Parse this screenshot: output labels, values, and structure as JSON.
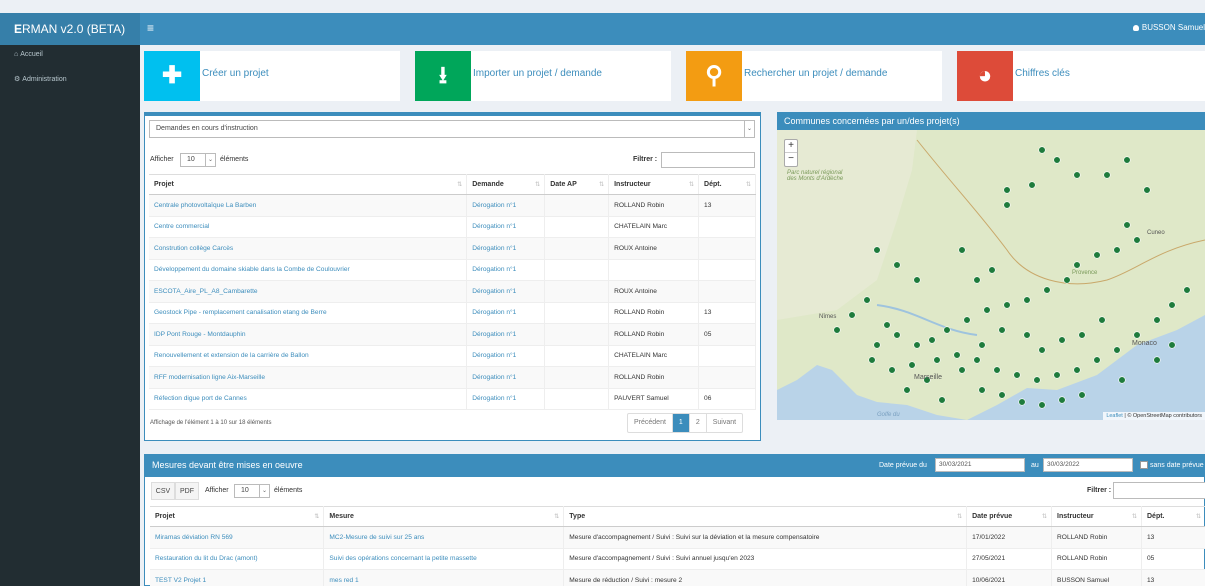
{
  "app": {
    "title_first": "E",
    "title_rest": "RMAN v2.0 (BETA)",
    "menu_glyph": "≡",
    "user": "BUSSON Samuel"
  },
  "sidebar": {
    "items": [
      {
        "icon": "home-icon",
        "label": "Accueil"
      },
      {
        "icon": "cogs-icon",
        "label": "Administration"
      }
    ]
  },
  "tiles": [
    {
      "icon": "plus-icon",
      "glyph": "✚",
      "label": "Créer un projet",
      "color": "#00c0ef"
    },
    {
      "icon": "download-icon",
      "glyph": "⭳",
      "label": "Importer un projet / demande",
      "color": "#00a65a"
    },
    {
      "icon": "search-icon",
      "glyph": "⚲",
      "label": "Rechercher un projet / demande",
      "color": "#f39c12"
    },
    {
      "icon": "pie-chart-icon",
      "glyph": "◕",
      "label": "Chiffres clés",
      "color": "#dd4b39"
    }
  ],
  "requests": {
    "select_value": "Demandes en cours d'instruction",
    "show_label": "Afficher",
    "page_size": "10",
    "elements_label": "éléments",
    "filter_label": "Filtrer :",
    "columns": [
      "Projet",
      "Demande",
      "Date AP",
      "Instructeur",
      "Dépt."
    ],
    "rows": [
      [
        "Centrale photovoltaïque La Barben",
        "Dérogation n°1",
        "",
        "ROLLAND Robin",
        "13"
      ],
      [
        "Centre commercial",
        "Dérogation n°1",
        "",
        "CHATELAIN Marc",
        ""
      ],
      [
        "Constrution collège Carcès",
        "Dérogation n°1",
        "",
        "ROUX Antoine",
        ""
      ],
      [
        "Développement du domaine skiable dans la Combe de Coulouvrier",
        "Dérogation n°1",
        "",
        "",
        ""
      ],
      [
        "ESCOTA_Aire_PL_A8_Cambarette",
        "Dérogation n°1",
        "",
        "ROUX Antoine",
        ""
      ],
      [
        "Geostock Pipe - remplacement canalisation etang de Berre",
        "Dérogation n°1",
        "",
        "ROLLAND Robin",
        "13"
      ],
      [
        "IDP Pont Rouge - Montdauphin",
        "Dérogation n°1",
        "",
        "ROLLAND Robin",
        "05"
      ],
      [
        "Renouvellement et extension de la carrière de Ballon",
        "Dérogation n°1",
        "",
        "CHATELAIN Marc",
        ""
      ],
      [
        "RFF modernisation ligne Aix-Marseille",
        "Dérogation n°1",
        "",
        "ROLLAND Robin",
        ""
      ],
      [
        "Réfection digue port de Cannes",
        "Dérogation n°1",
        "",
        "PAUVERT Samuel",
        "06"
      ]
    ],
    "info": "Affichage de l'élément 1 à 10 sur 18 éléments",
    "pager": {
      "prev": "Précédent",
      "pages": [
        "1",
        "2"
      ],
      "next": "Suivant",
      "current": "1"
    }
  },
  "map": {
    "title": "Communes concernées par un/des projet(s)",
    "zoom_in": "+",
    "zoom_out": "−",
    "attribution_leaflet": "Leaflet",
    "attribution_rest": " | © OpenStreetMap contributors",
    "place_labels": [
      "Parc naturel régional des Monts d'Ardèche",
      "Nîmes",
      "Marseille",
      "Monaco",
      "Cuneo",
      "Provence",
      "Golfe du"
    ],
    "colors": {
      "land": "#dfe8c8",
      "sea": "#b9d3e8",
      "marker": "#1e7b3c"
    }
  },
  "measures": {
    "title": "Mesures devant être mises en oeuvre",
    "date_label": "Date prévue du",
    "date_from": "30/03/2021",
    "date_to_label": "au",
    "date_to": "30/03/2022",
    "no_date_label": "sans date prévue",
    "csv": "CSV",
    "pdf": "PDF",
    "show_label": "Afficher",
    "page_size": "10",
    "elements_label": "éléments",
    "filter_label": "Filtrer :",
    "columns": [
      "Projet",
      "Mesure",
      "Type",
      "Date prévue",
      "Instructeur",
      "Dépt."
    ],
    "rows": [
      [
        "Miramas déviation RN 569",
        "MC2-Mesure de suivi sur 25 ans",
        "Mesure d'accompagnement / Suivi : Suivi sur la déviation et la mesure compensatoire",
        "17/01/2022",
        "ROLLAND Robin",
        "13"
      ],
      [
        "Restauration du lit du Drac (amont)",
        "Suivi des opérations concernant la petite massette",
        "Mesure d'accompagnement / Suivi : Suivi annuel jusqu'en 2023",
        "27/05/2021",
        "ROLLAND Robin",
        "05"
      ],
      [
        "TEST V2 Projet 1",
        "mes red 1",
        "Mesure de réduction / Suivi : mesure 2",
        "10/06/2021",
        "BUSSON Samuel",
        "13"
      ]
    ]
  }
}
